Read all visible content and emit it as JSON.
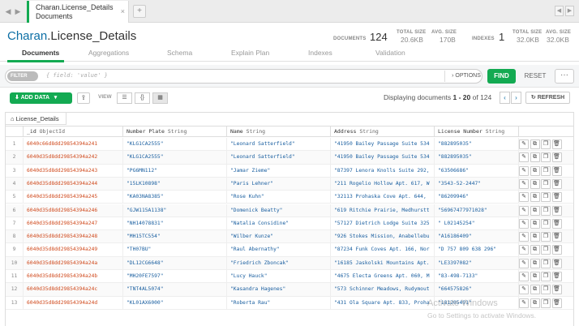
{
  "tabbar": {
    "back_icon": "chevron-left",
    "forward_icon": "chevron-right",
    "tab_title": "Charan.License_Details",
    "tab_subtitle": "Documents",
    "tab_close": "×",
    "new_tab": "+"
  },
  "header": {
    "db_name": "Charan",
    "collection_name": ".License_Details",
    "documents_label": "DOCUMENTS",
    "documents_count": "124",
    "total_size_label": "TOTAL SIZE",
    "total_size_value": "20.6KB",
    "avg_size_label": "AVG. SIZE",
    "avg_size_value": "170B",
    "indexes_label": "INDEXES",
    "indexes_count": "1",
    "idx_total_size_label": "TOTAL SIZE",
    "idx_total_size_value": "32.0KB",
    "idx_avg_size_label": "AVG. SIZE",
    "idx_avg_size_value": "32.0KB"
  },
  "subtabs": [
    "Documents",
    "Aggregations",
    "Schema",
    "Explain Plan",
    "Indexes",
    "Validation"
  ],
  "filter": {
    "pill": "FILTER",
    "placeholder": "{ field: 'value' }",
    "options": "› OPTIONS",
    "find": "FIND",
    "reset": "RESET",
    "more": "···"
  },
  "toolbar": {
    "add_data": "ADD DATA",
    "view_label": "VIEW",
    "displaying_prefix": "Displaying documents ",
    "displaying_range": "1 - 20",
    "displaying_suffix": " of 124",
    "refresh": "REFRESH"
  },
  "table": {
    "tab_label": "License_Details",
    "columns": [
      {
        "name": "_id",
        "type": "ObjectId"
      },
      {
        "name": "Number Plate",
        "type": "String"
      },
      {
        "name": "Name",
        "type": "String"
      },
      {
        "name": "Address",
        "type": "String"
      },
      {
        "name": "License Number",
        "type": "String"
      }
    ],
    "rows": [
      {
        "n": "1",
        "id": "6040c66d8dd29854394a241",
        "plate": "\"KLG1CA2555\"",
        "name": "\"Leonard Satterfield\"",
        "addr": "\"41950 Bailey Passage Suite 534",
        "lic": "\"882895035\""
      },
      {
        "n": "2",
        "id": "6040d35d8dd29854394a242",
        "plate": "\"KLG1CA2555\"",
        "name": "\"Leonard Satterfield\"",
        "addr": "\"41950 Bailey Passage Suite 534",
        "lic": "\"882895035\""
      },
      {
        "n": "3",
        "id": "6040d35d8dd29854394a243",
        "plate": "\"PG6MN112\"",
        "name": "\"Jamar Zieme\"",
        "addr": "\"87397 Lenora Knolls Suite 292,",
        "lic": "\"63506686\""
      },
      {
        "n": "4",
        "id": "6040d35d8dd29854394a244",
        "plate": "\"15LK10898\"",
        "name": "\"Paris Lehner\"",
        "addr": "\"211 Rogelio Hollow Apt. 617, W",
        "lic": "\"3543-52-2447\""
      },
      {
        "n": "5",
        "id": "6040d35d8dd29854394a245",
        "plate": "\"KA03NA8385\"",
        "name": "\"Rose Kuhn\"",
        "addr": "\"32113 Prohaska Cove Apt. 644,",
        "lic": "\"86209946\""
      },
      {
        "n": "6",
        "id": "6040d35d8dd29854394a246",
        "plate": "\"GJW115A1138\"",
        "name": "\"Domenick Beatty\"",
        "addr": "\"619 Ritchie Prairie, Medhurstt",
        "lic": "\"56967477971028\""
      },
      {
        "n": "7",
        "id": "6040d35d8dd29854394a247",
        "plate": "\"NH14078831\"",
        "name": "\"Natalia Considine\"",
        "addr": "\"57127 Dietrich Lodge Suite 325",
        "lic": "\" L02145254\""
      },
      {
        "n": "8",
        "id": "6040d35d8dd29854394a248",
        "plate": "\"MH15TC554\"",
        "name": "\"Wilber Kunze\"",
        "addr": "\"926 Stokes Mission, Anabellebu",
        "lic": "\"A16186409\""
      },
      {
        "n": "9",
        "id": "6040d35d8dd29854394a249",
        "plate": "\"TH07BU\"",
        "name": "\"Raul Abernathy\"",
        "addr": "\"87234 Funk Coves Apt. 166, Nor",
        "lic": "\"D 757 809 638 296\""
      },
      {
        "n": "10",
        "id": "6040d35d8dd29854394a24a",
        "plate": "\"DL12CG6648\"",
        "name": "\"Friedrich Zboncak\"",
        "addr": "\"16185 Jaskolski Mountains Apt.",
        "lic": "\"LE3397082\""
      },
      {
        "n": "11",
        "id": "6040d35d8dd29854394a24b",
        "plate": "\"MH20FE7597\"",
        "name": "\"Lucy Hauck\"",
        "addr": "\"4675 Electa Greens Apt. 060, M",
        "lic": "\"83-498-7133\""
      },
      {
        "n": "12",
        "id": "6040d35d8dd29854394a24c",
        "plate": "\"TNT4AL5074\"",
        "name": "\"Kasandra Hagenes\"",
        "addr": "\"573 Schinner Meadows, Rudymout",
        "lic": "\"664575826\""
      },
      {
        "n": "13",
        "id": "6040d35d8dd29854394a24d",
        "plate": "\"KL01AX6000\"",
        "name": "\"Roberta Rau\"",
        "addr": "\"431 Ola Square Apt. 833, Proha",
        "lic": "\"181205491\""
      }
    ]
  },
  "watermark": {
    "line1": "Activate Windows",
    "line2": "Go to Settings to activate Windows."
  }
}
